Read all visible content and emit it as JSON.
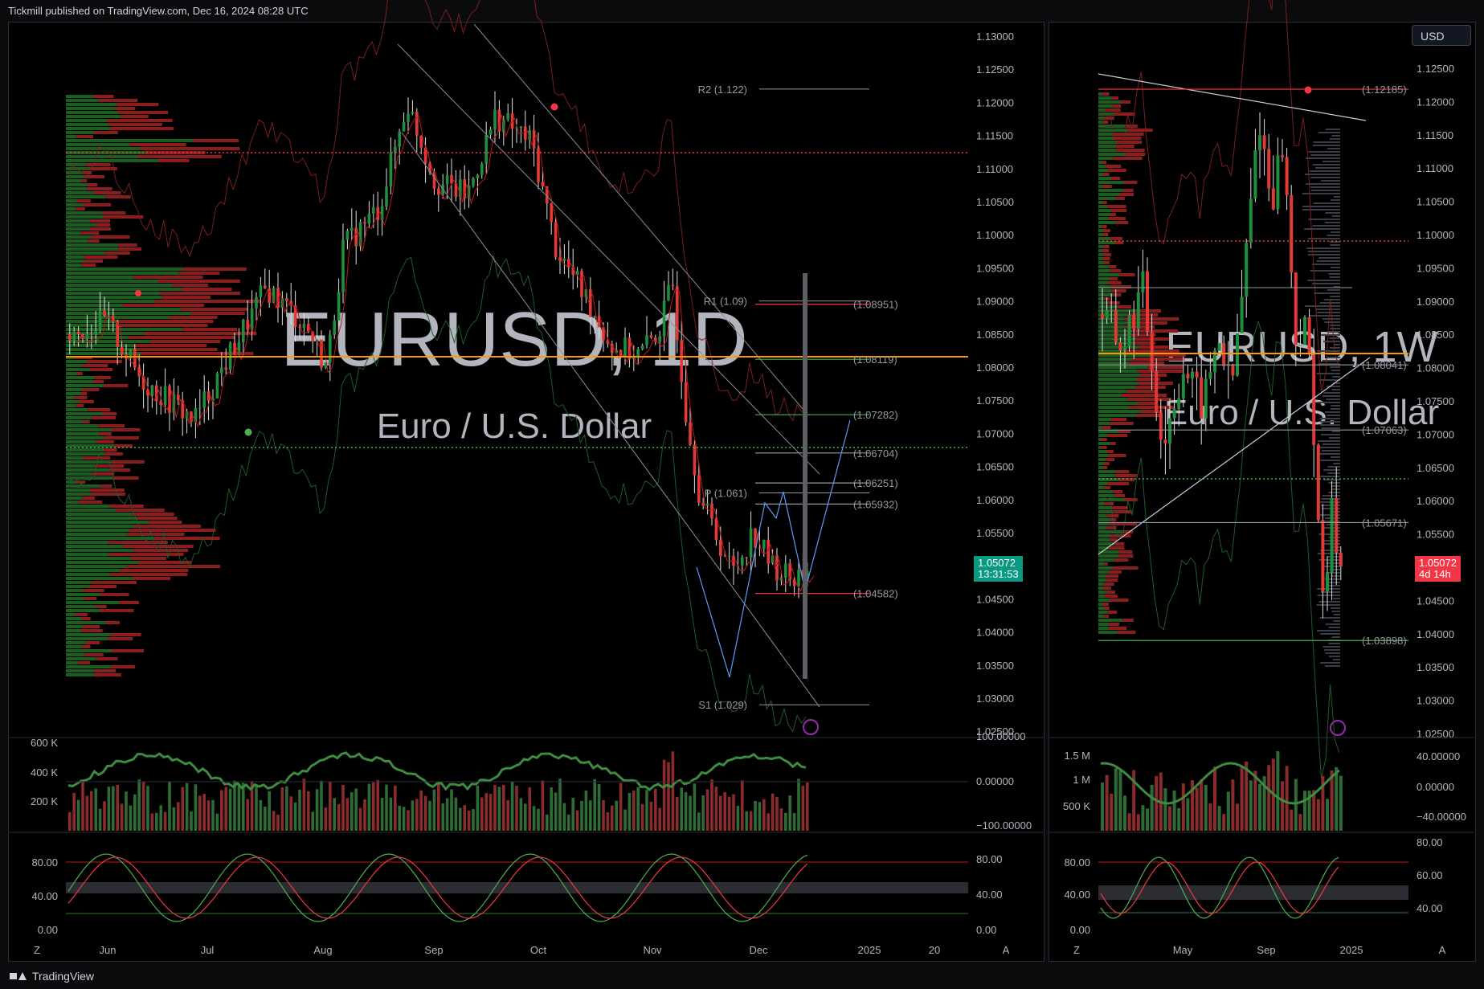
{
  "header": {
    "text": "Tickmill published on TradingView.com, Dec 16, 2024 08:28 UTC"
  },
  "footer": {
    "brand": "TradingView"
  },
  "currency_button": "USD",
  "colors": {
    "bull": "#26a69a",
    "bull_dark": "#1b5e20",
    "bear": "#d32f2f",
    "bear_dark": "#8b1d1d",
    "orange": "#ff9800",
    "blue": "#5b9cf6"
  },
  "left_chart": {
    "watermark_symbol": "EURUSD, 1D",
    "watermark_name": "Euro / U.S. Dollar",
    "price_axis": [
      "1.13000",
      "1.12500",
      "1.12000",
      "1.11500",
      "1.11000",
      "1.10500",
      "1.10000",
      "1.09500",
      "1.09000",
      "1.08500",
      "1.08000",
      "1.07500",
      "1.07000",
      "1.06500",
      "1.06000",
      "1.05500",
      "1.05000",
      "1.04500",
      "1.04000",
      "1.03500",
      "1.03000",
      "1.02500"
    ],
    "current_price": "1.05072",
    "countdown": "13:31:53",
    "pivots": [
      {
        "label": "R2 (1.122)",
        "price": 1.122
      },
      {
        "label": "R1 (1.09)",
        "price": 1.09
      },
      {
        "label": "P (1.061)",
        "price": 1.061
      },
      {
        "label": "S1 (1.029)",
        "price": 1.029
      }
    ],
    "levels": [
      {
        "label": "(1.08951)",
        "price": 1.08951,
        "color": "#f23645"
      },
      {
        "label": "(1.08119)",
        "price": 1.08119,
        "color": "#4caf50"
      },
      {
        "label": "(1.07282)",
        "price": 1.07282,
        "color": "#4caf50"
      },
      {
        "label": "(1.06704)",
        "price": 1.06704,
        "color": "#9598a1"
      },
      {
        "label": "(1.06251)",
        "price": 1.06251,
        "color": "#9598a1"
      },
      {
        "label": "(1.05932)",
        "price": 1.05932,
        "color": "#9598a1"
      },
      {
        "label": "(1.04582)",
        "price": 1.04582,
        "color": "#f23645"
      }
    ],
    "time_axis": [
      "Jun",
      "Jul",
      "Aug",
      "Sep",
      "Oct",
      "Nov",
      "Dec",
      "2025",
      "20"
    ],
    "volume_axis": [
      "600 K",
      "400 K",
      "200 K"
    ],
    "volume_right_axis": [
      "100.00000",
      "0.00000",
      "−100.00000"
    ],
    "stoch_axis": [
      "80.00",
      "40.00",
      "0.00"
    ],
    "stoch_right_axis": [
      "80.00",
      "40.00",
      "0.00"
    ]
  },
  "right_chart": {
    "watermark_symbol": "EURUSD, 1W",
    "watermark_name": "Euro / U.S. Dollar",
    "price_axis": [
      "1.12500",
      "1.12000",
      "1.11500",
      "1.11000",
      "1.10500",
      "1.10000",
      "1.09500",
      "1.09000",
      "1.08500",
      "1.08000",
      "1.07500",
      "1.07000",
      "1.06500",
      "1.06000",
      "1.05500",
      "1.05000",
      "1.04500",
      "1.04000",
      "1.03500",
      "1.03000",
      "1.02500"
    ],
    "current_price": "1.05072",
    "countdown": "4d 14h",
    "levels": [
      {
        "label": "(1.12185)",
        "price": 1.12185,
        "color": "#f23645"
      },
      {
        "label": "(1.08041)",
        "price": 1.08041,
        "color": "#9598a1"
      },
      {
        "label": "(1.07063)",
        "price": 1.07063,
        "color": "#9598a1"
      },
      {
        "label": "(1.05671)",
        "price": 1.05671,
        "color": "#9598a1"
      },
      {
        "label": "(1.03898)",
        "price": 1.03898,
        "color": "#4caf50"
      }
    ],
    "time_axis": [
      "May",
      "Sep",
      "2025"
    ],
    "volume_axis": [
      "1.5 M",
      "1 M",
      "500 K"
    ],
    "volume_right_axis": [
      "40.00000",
      "0.00000",
      "−40.00000"
    ],
    "stoch_axis": [
      "80.00",
      "40.00",
      "0.00"
    ],
    "stoch_right_axis": [
      "80.00",
      "60.00",
      "40.00"
    ]
  }
}
